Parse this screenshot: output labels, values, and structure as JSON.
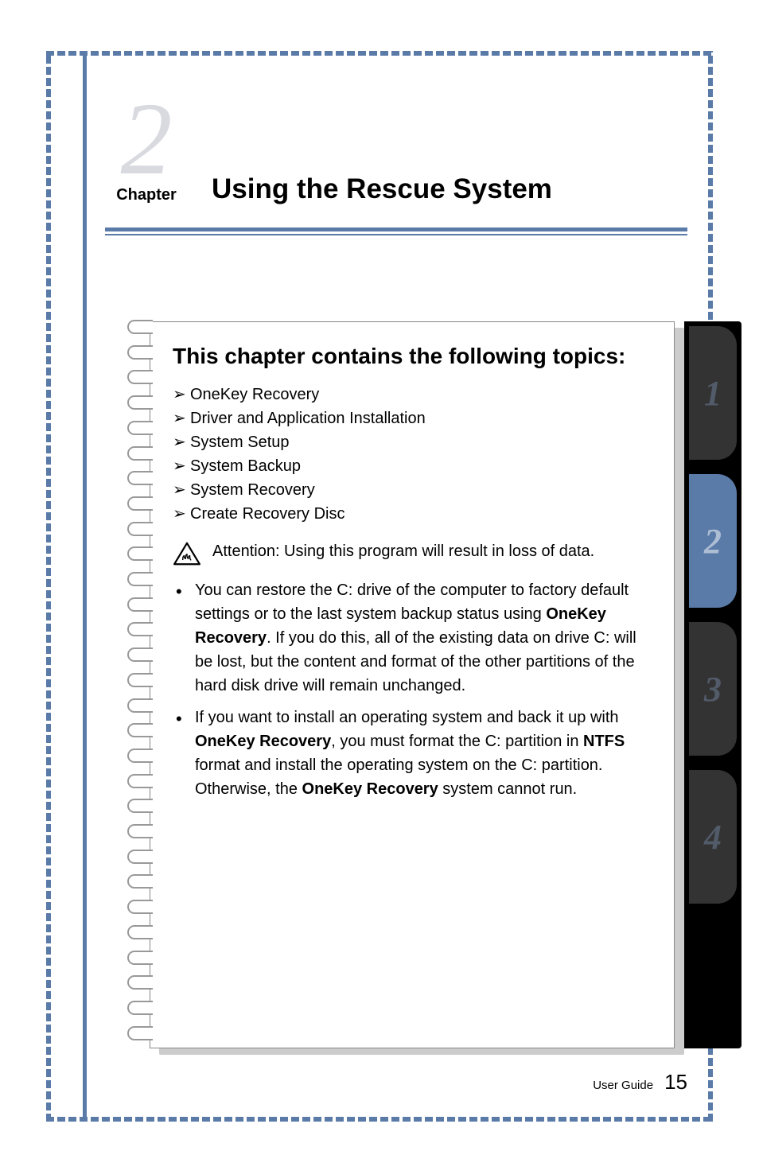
{
  "chapter": {
    "number": "2",
    "label": "Chapter",
    "title": "Using the Rescue System"
  },
  "intro_heading": "This chapter contains the following topics:",
  "topics": [
    "OneKey Recovery",
    "Driver and Application Installation",
    "System Setup",
    "System Backup",
    "System Recovery",
    "Create Recovery Disc"
  ],
  "attention": {
    "label": "Attention: Using this program will result in loss of data."
  },
  "bullets": [
    {
      "pre": "You can restore the C: drive of the computer to factory default settings or to the last system backup status using ",
      "bold1": "OneKey Recovery",
      "post": ". If you do this, all of the existing data on drive C: will be lost, but the content and format of the other partitions of the hard disk drive will remain unchanged."
    },
    {
      "pre": "If you want to install an operating system and back it up with ",
      "bold1": "OneKey Recovery",
      "mid1": ", you must format the C: partition in ",
      "bold2": "NTFS",
      "mid2": " format and install the operating system on the C: partition. Otherwise, the ",
      "bold3": "OneKey Recovery",
      "post": " system cannot run."
    }
  ],
  "tabs": [
    "1",
    "2",
    "3",
    "4"
  ],
  "active_tab_index": 1,
  "footer": {
    "guide": "User Guide",
    "page": "15"
  }
}
